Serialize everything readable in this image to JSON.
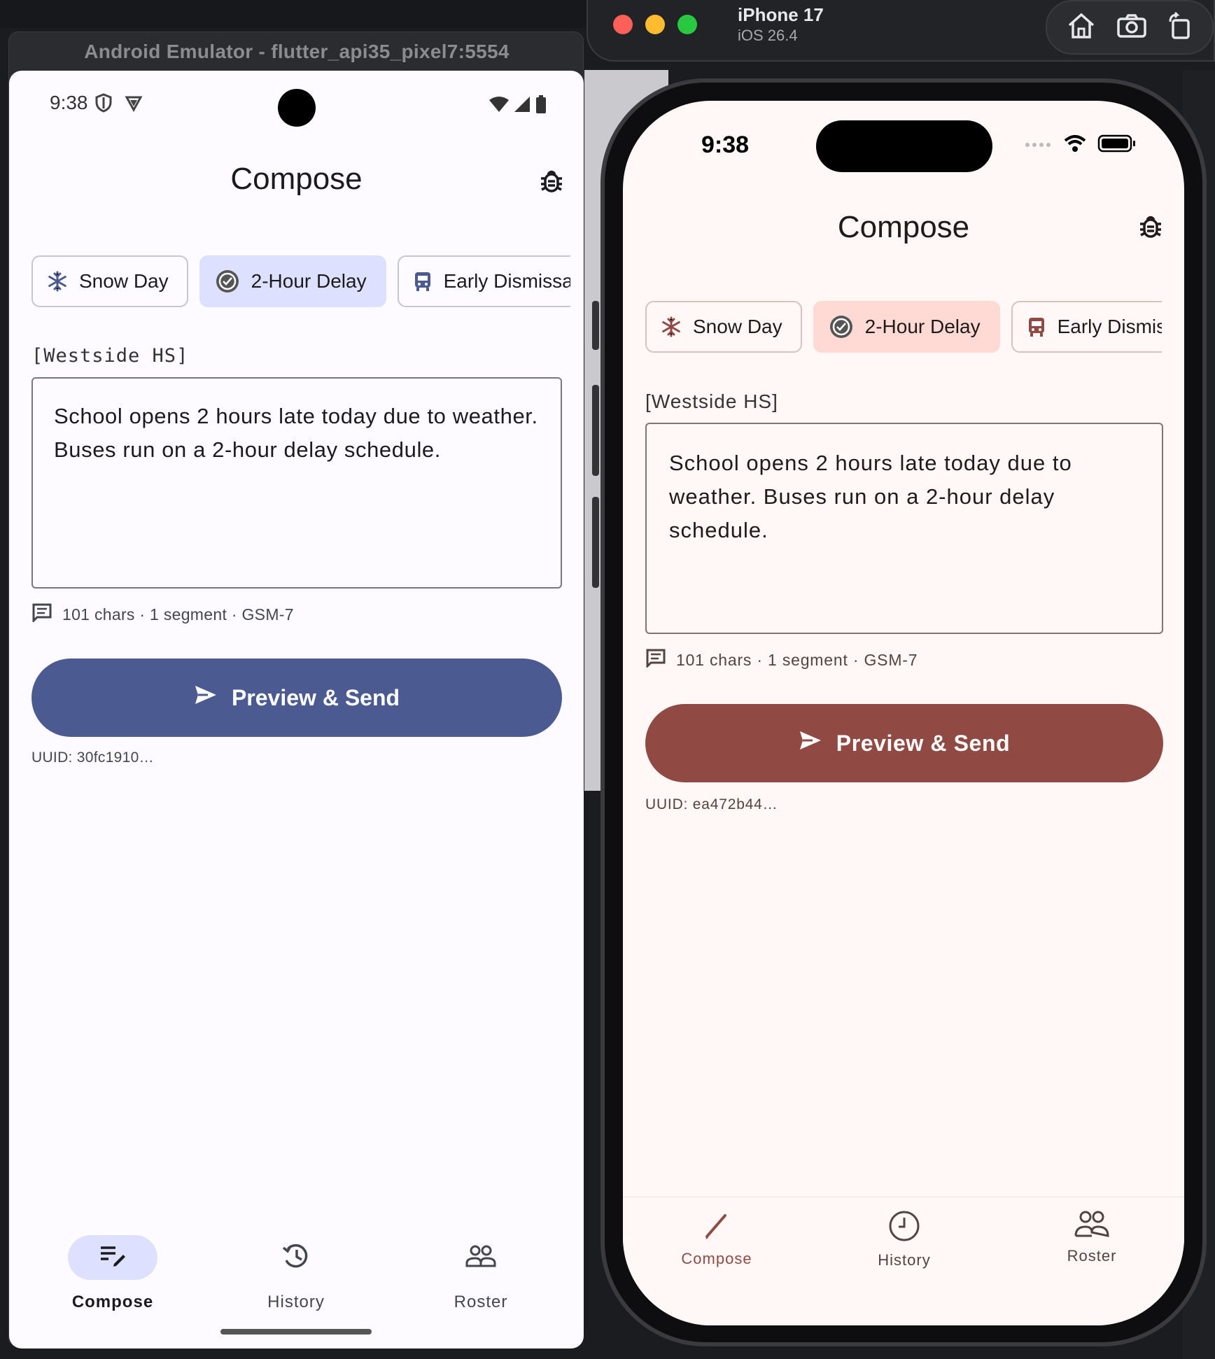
{
  "android": {
    "window_title": "Android Emulator - flutter_api35_pixel7:5554",
    "status_time": "9:38",
    "app_title": "Compose",
    "chips": [
      {
        "label": "Snow Day",
        "icon": "snowflake-icon"
      },
      {
        "label": "2-Hour Delay",
        "icon": "clock-check-icon",
        "selected": true
      },
      {
        "label": "Early Dismissal",
        "icon": "bus-icon"
      }
    ],
    "school_label": "[Westside HS]",
    "message": "School opens 2 hours late today due to weather. Buses run on a 2-hour delay schedule.",
    "meta": "101 chars · 1 segment · GSM-7",
    "send_button": "Preview & Send",
    "uuid": "UUID: 30fc1910…",
    "nav": [
      {
        "label": "Compose",
        "icon": "compose-icon",
        "active": true
      },
      {
        "label": "History",
        "icon": "history-icon"
      },
      {
        "label": "Roster",
        "icon": "roster-icon"
      }
    ],
    "accent": "#4b5a91"
  },
  "ios_sim": {
    "device_name": "iPhone 17",
    "os_version": "iOS 26.4"
  },
  "ios": {
    "status_time": "9:38",
    "app_title": "Compose",
    "chips": [
      {
        "label": "Snow Day",
        "icon": "snowflake-icon"
      },
      {
        "label": "2-Hour Delay",
        "icon": "clock-check-icon",
        "selected": true
      },
      {
        "label": "Early Dismissal",
        "icon": "bus-icon"
      }
    ],
    "school_label": "[Westside HS]",
    "message": "School opens 2 hours late today due to weather. Buses run on a 2-hour delay schedule.",
    "meta": "101 chars · 1 segment · GSM-7",
    "send_button": "Preview & Send",
    "uuid": "UUID: ea472b44…",
    "nav": [
      {
        "label": "Compose",
        "icon": "pencil-icon",
        "active": true
      },
      {
        "label": "History",
        "icon": "clock-icon"
      },
      {
        "label": "Roster",
        "icon": "roster-icon"
      }
    ],
    "accent": "#904a43"
  }
}
